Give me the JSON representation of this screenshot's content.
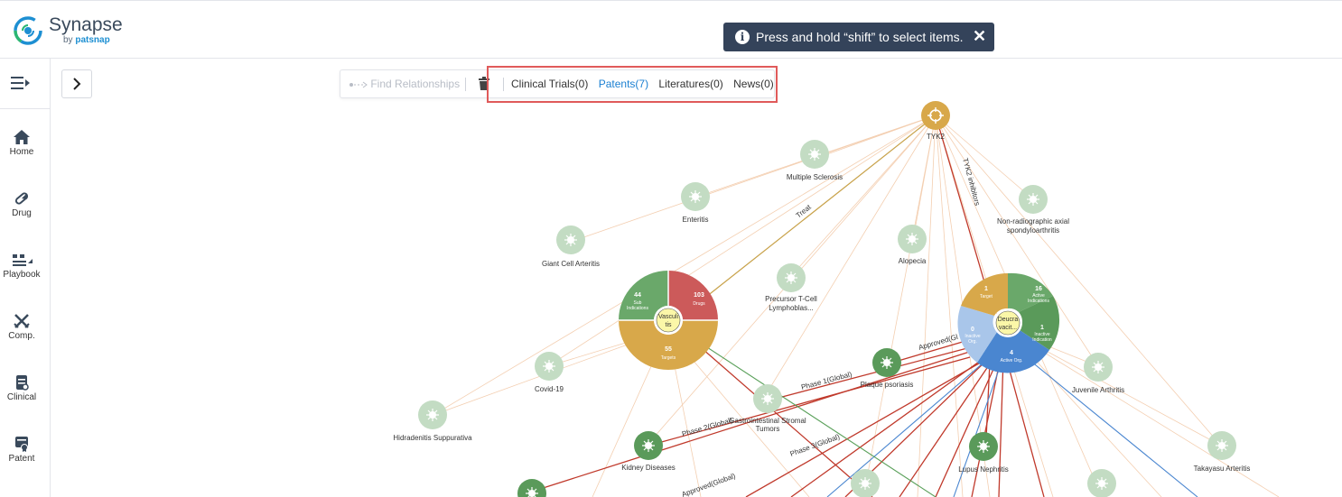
{
  "brand": {
    "name": "Synapse",
    "by": "by",
    "vendor": "patsnap",
    "accent": "#1d8fd2"
  },
  "toast": {
    "message": "Press and hold “shift” to select items.",
    "info_icon": "info-icon",
    "close_icon": "close-icon"
  },
  "sidebar": {
    "items": [
      {
        "label": "Home",
        "icon": "home-icon"
      },
      {
        "label": "Drug",
        "icon": "pill-icon"
      },
      {
        "label": "Playbook",
        "icon": "playbook-icon"
      },
      {
        "label": "Comp.",
        "icon": "competition-icon"
      },
      {
        "label": "Clinical",
        "icon": "clinical-icon"
      },
      {
        "label": "Patent",
        "icon": "patent-icon"
      }
    ]
  },
  "toolbar": {
    "find_relationships": "Find Relationships",
    "tabs": [
      {
        "label": "Clinical Trials(0)",
        "active": false
      },
      {
        "label": "Patents(7)",
        "active": true
      },
      {
        "label": "Literatures(0)",
        "active": false
      },
      {
        "label": "News(0)",
        "active": false
      }
    ]
  },
  "graph": {
    "target": {
      "label": "TYK2"
    },
    "diseases": [
      "Multiple Sclerosis",
      "Enteritis",
      "Non-radiographic axial",
      "spondyloarthritis",
      "Giant Cell Arteritis",
      "Alopecia",
      "Precursor T-Cell",
      "Lymphoblas...",
      "Covid-19",
      "Plaque psoriasis",
      "Juvenile Arthritis",
      "Hidradenitis Suppurativa",
      "Gastrointestinal Stromal",
      "Tumors",
      "Kidney Diseases",
      "Lupus Nephritis",
      "Takayasu Arteritis"
    ],
    "vasculitis": {
      "center": [
        "Vasculi",
        "tis"
      ],
      "segments": [
        {
          "count": "103",
          "label": "Drugs",
          "color": "#cc5a5a"
        },
        {
          "count": "55",
          "label": "Targets",
          "color": "#d8a84a"
        },
        {
          "count": "44",
          "label": "Sub",
          "label2": "Indications",
          "color": "#6aa86a"
        }
      ]
    },
    "deucravacitinib": {
      "center": [
        "Deucra",
        "vacit..."
      ],
      "segments": [
        {
          "count": "16",
          "label": "Active",
          "label2": "Indications",
          "color": "#6aa86a"
        },
        {
          "count": "1",
          "label": "Inactive",
          "label2": "Indication",
          "color": "#5a9a5a"
        },
        {
          "count": "4",
          "label": "Active Org.",
          "color": "#4a86d0"
        },
        {
          "count": "0",
          "label": "Inactive",
          "label2": "Org.",
          "color": "#a9c6ea"
        },
        {
          "count": "1",
          "label": "Target",
          "color": "#d8a84a"
        }
      ]
    },
    "edge_labels": [
      "Treat",
      "TYK2 inhibitors",
      "Approved(Gl",
      "Phase 1(Global)",
      "Phase 2(Global)",
      "Phase 3(Global)",
      "Approved(Global)"
    ]
  }
}
